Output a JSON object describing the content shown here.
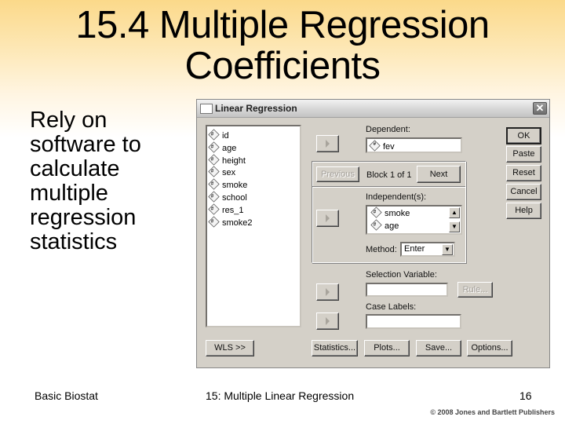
{
  "slide": {
    "title_line1": "15.4 Multiple Regression",
    "title_line2": "Coefficients",
    "bullet": "Rely on software to calculate multiple regression statistics",
    "footer_left": "Basic Biostat",
    "footer_center": "15: Multiple Linear Regression",
    "page_number": "16",
    "copyright": "© 2008 Jones and Bartlett Publishers"
  },
  "dialog": {
    "title": "Linear Regression",
    "close_icon": "close-icon",
    "variable_icon": "#",
    "variables": [
      "id",
      "age",
      "height",
      "sex",
      "smoke",
      "school",
      "res_1",
      "smoke2"
    ],
    "dependent_label": "Dependent:",
    "dependent_value": "fev",
    "previous_label": "Previous",
    "block_label": "Block 1 of 1",
    "next_label": "Next",
    "independent_label": "Independent(s):",
    "independents": [
      "smoke",
      "age"
    ],
    "method_label": "Method:",
    "method_value": "Enter",
    "selection_label": "Selection Variable:",
    "rule_label": "Rule...",
    "case_labels_label": "Case Labels:",
    "buttons": {
      "ok": "OK",
      "paste": "Paste",
      "reset": "Reset",
      "cancel": "Cancel",
      "help": "Help",
      "wls": "WLS >>",
      "statistics": "Statistics...",
      "plots": "Plots...",
      "save": "Save...",
      "options": "Options..."
    }
  }
}
